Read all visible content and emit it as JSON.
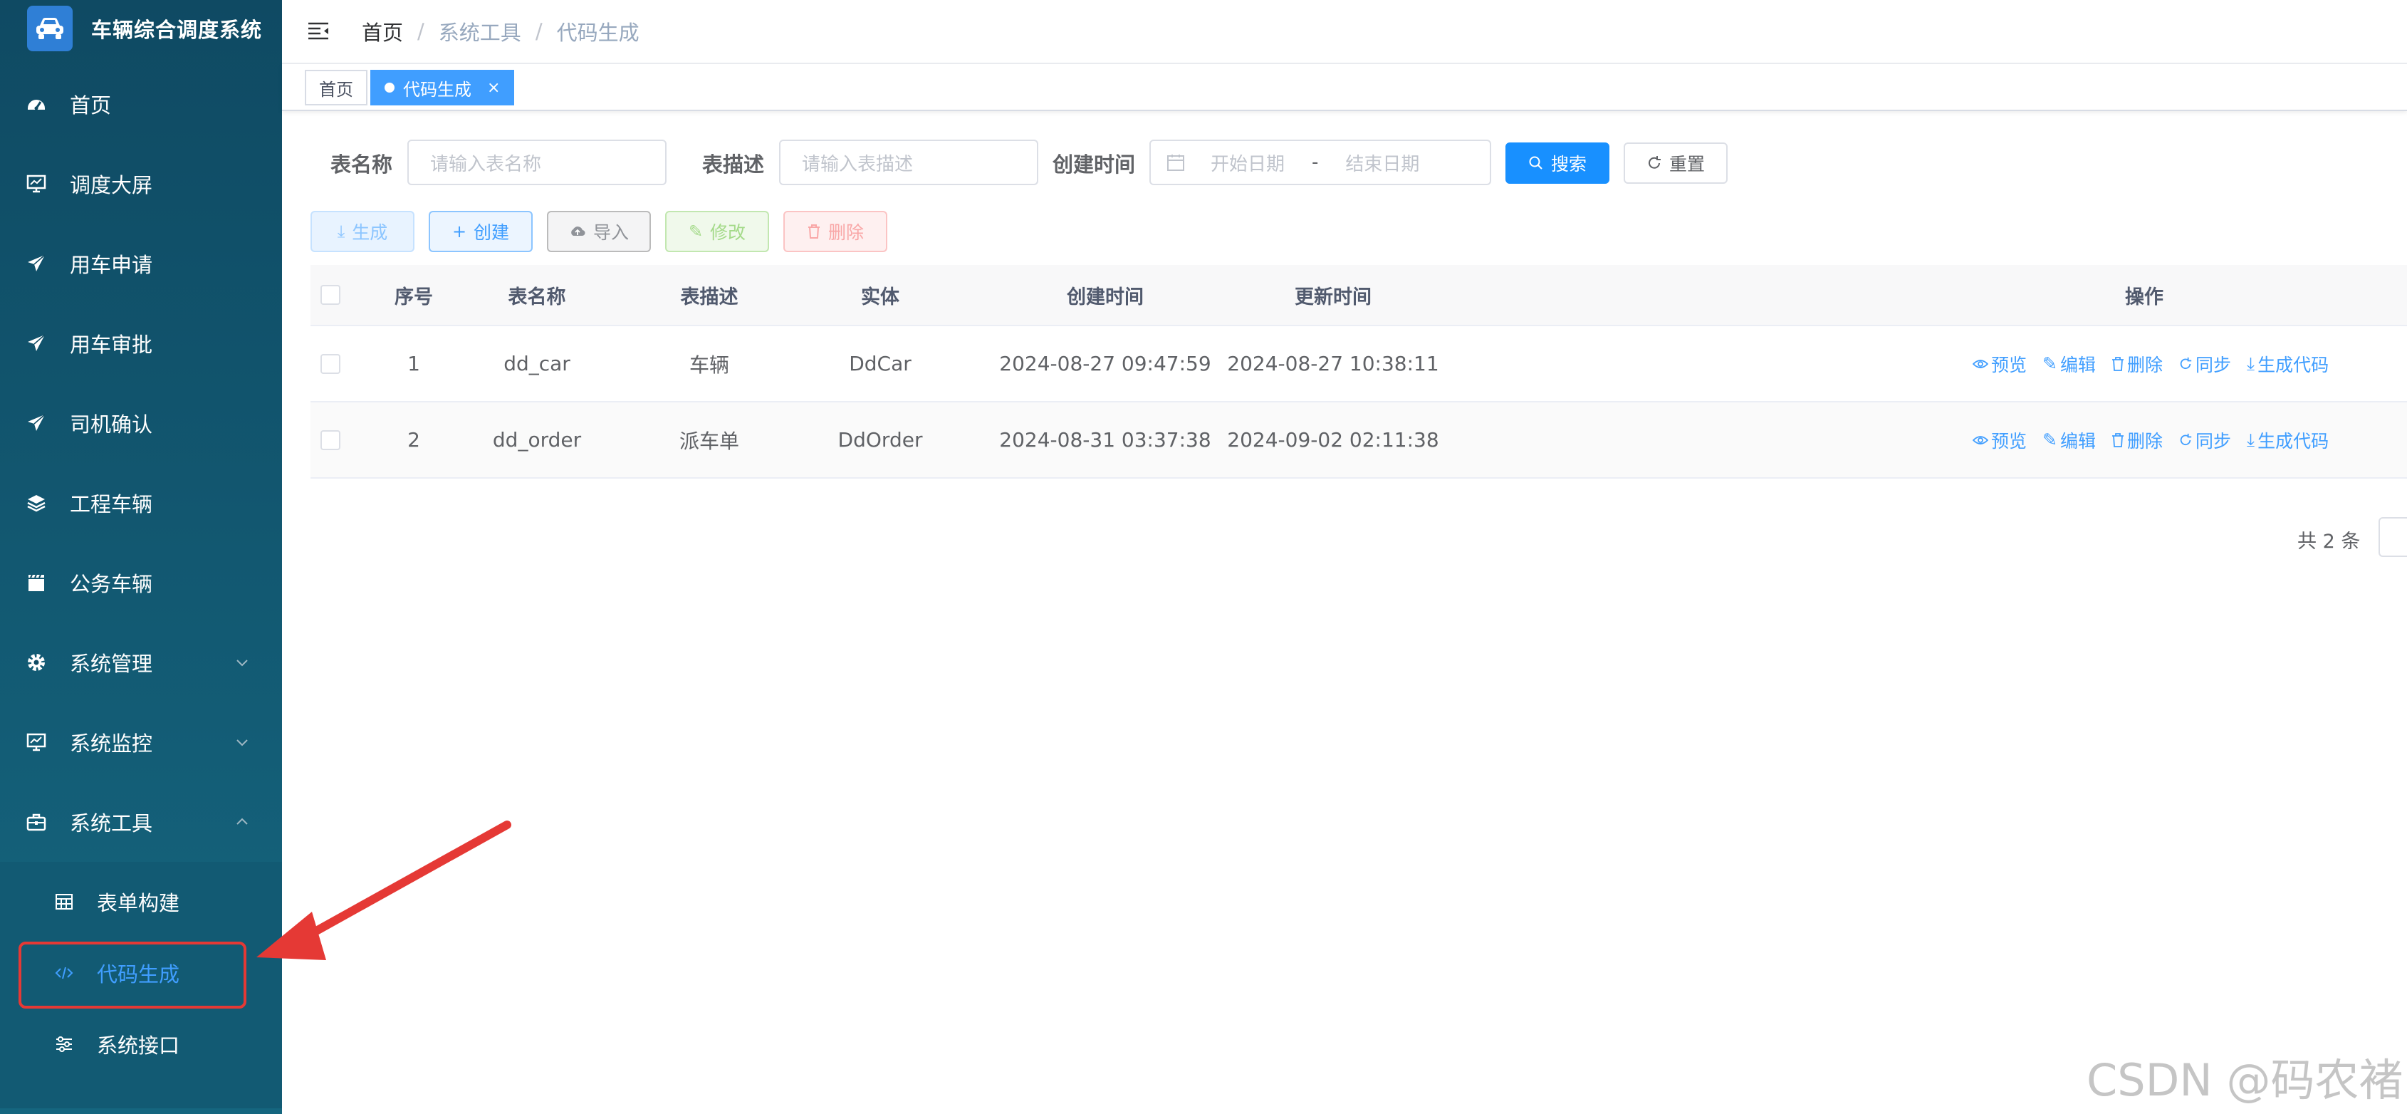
{
  "app": {
    "title": "车辆综合调度系统"
  },
  "sidebar": {
    "items": [
      {
        "label": "首页",
        "icon": "dashboard-icon"
      },
      {
        "label": "调度大屏",
        "icon": "monitor-icon"
      },
      {
        "label": "用车申请",
        "icon": "send-icon"
      },
      {
        "label": "用车审批",
        "icon": "send-icon"
      },
      {
        "label": "司机确认",
        "icon": "send-icon"
      },
      {
        "label": "工程车辆",
        "icon": "layers-icon"
      },
      {
        "label": "公务车辆",
        "icon": "clapper-icon"
      },
      {
        "label": "系统管理",
        "icon": "gear-icon",
        "expandable": true
      },
      {
        "label": "系统监控",
        "icon": "monitor-icon",
        "expandable": true
      },
      {
        "label": "系统工具",
        "icon": "toolbox-icon",
        "expanded": true
      }
    ],
    "subitems": [
      {
        "label": "表单构建",
        "icon": "table-icon"
      },
      {
        "label": "代码生成",
        "icon": "code-icon",
        "active": true
      },
      {
        "label": "系统接口",
        "icon": "sliders-icon"
      }
    ]
  },
  "header": {
    "breadcrumb": [
      "首页",
      "系统工具",
      "代码生成"
    ],
    "separator": "/"
  },
  "tags": [
    {
      "label": "首页"
    },
    {
      "label": "代码生成",
      "active": true,
      "close": "×"
    }
  ],
  "search": {
    "table_name_label": "表名称",
    "table_name_placeholder": "请输入表名称",
    "table_desc_label": "表描述",
    "table_desc_placeholder": "请输入表描述",
    "created_label": "创建时间",
    "start_placeholder": "开始日期",
    "range_sep": "-",
    "end_placeholder": "结束日期",
    "search_button": "搜索",
    "reset_button": "重置"
  },
  "toolbar": {
    "generate": "生成",
    "create": "创建",
    "import": "导入",
    "edit": "修改",
    "delete": "删除"
  },
  "table": {
    "columns": [
      "序号",
      "表名称",
      "表描述",
      "实体",
      "创建时间",
      "更新时间",
      "操作"
    ],
    "rows": [
      {
        "index": "1",
        "name": "dd_car",
        "desc": "车辆",
        "entity": "DdCar",
        "created": "2024-08-27 09:47:59",
        "updated": "2024-08-27 10:38:11"
      },
      {
        "index": "2",
        "name": "dd_order",
        "desc": "派车单",
        "entity": "DdOrder",
        "created": "2024-08-31 03:37:38",
        "updated": "2024-09-02 02:11:38"
      }
    ],
    "actions": [
      "预览",
      "编辑",
      "删除",
      "同步",
      "生成代码"
    ]
  },
  "pagination": {
    "total_text": "共 2 条"
  },
  "watermark": "CSDN @码农褚",
  "colors": {
    "primary": "#1890ff",
    "sidebar": "#0f4a63",
    "active_link": "#409eff",
    "annotation": "#e53935"
  }
}
